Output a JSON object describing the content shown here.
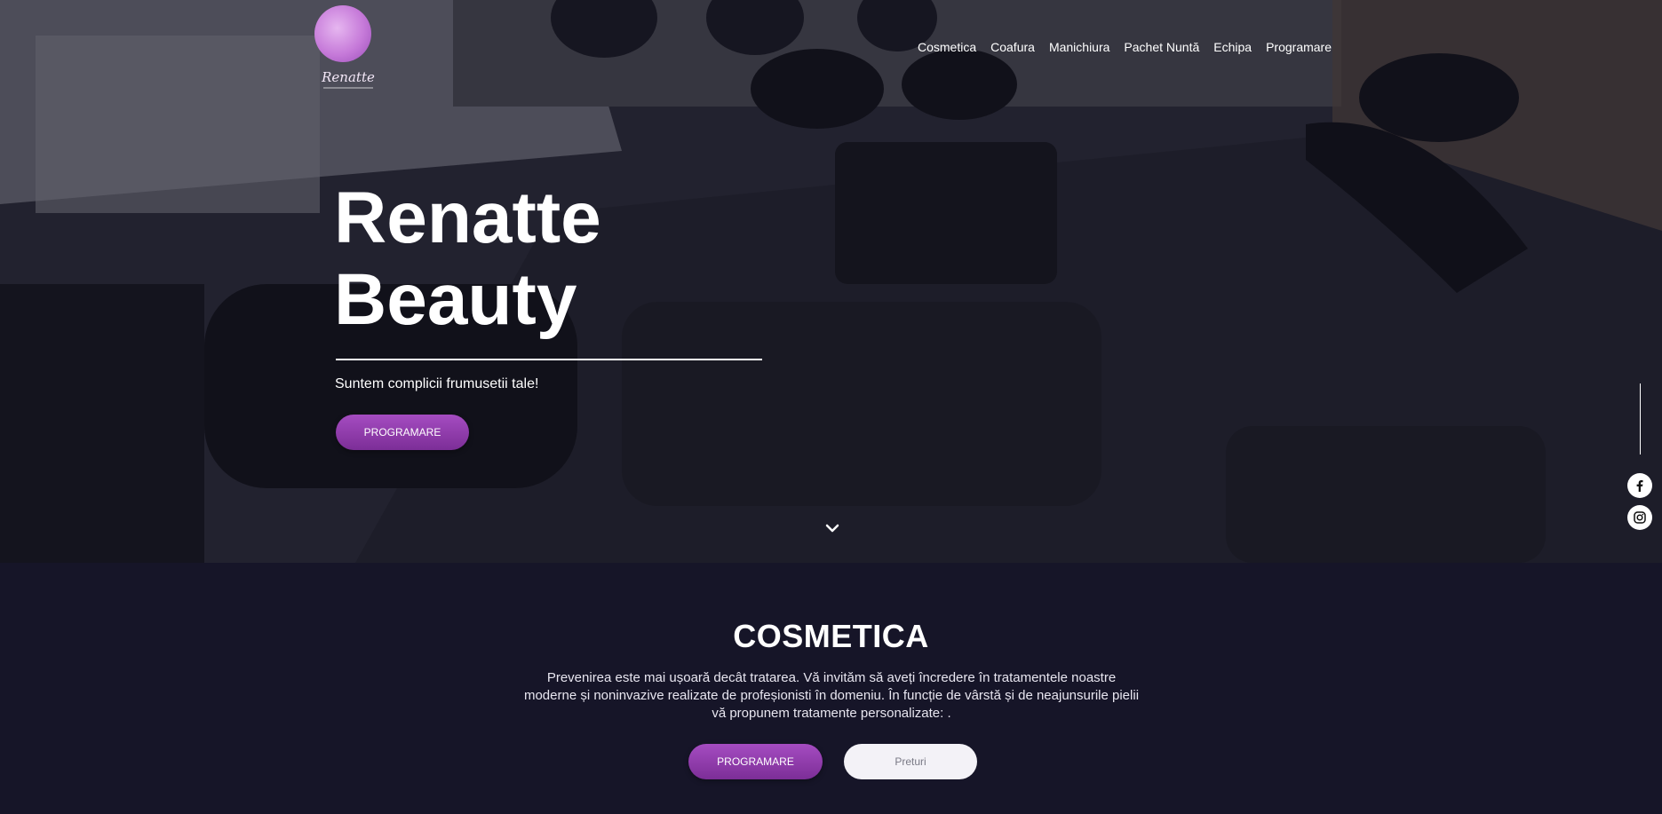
{
  "brand": {
    "logo_text": "Renatte"
  },
  "nav": {
    "items": [
      "Cosmetica",
      "Coafura",
      "Manichiura",
      "Pachet Nuntă",
      "Echipa",
      "Programare"
    ]
  },
  "hero": {
    "title_line1": "Renatte",
    "title_line2": "Beauty",
    "subtitle": "Suntem complicii frumusetii tale!",
    "button_label": "PROGRAMARE"
  },
  "icons": {
    "scroll": "chevron-down-icon",
    "facebook": "facebook-icon",
    "instagram": "instagram-icon"
  },
  "section": {
    "title": "COSMETICA",
    "text": "Prevenirea este mai ușoară decât tratarea. Vă invităm să aveți încredere în tratamentele noastre moderne și noninvazive realizate de profeșionisti în domeniu. În funcție de vârstă și de neajunsurile pielii vă propunem tratamente personalizate: .",
    "primary_button": "PROGRAMARE",
    "secondary_button": "Preturi"
  },
  "colors": {
    "accent": "#9b45b8",
    "section_bg": "#161528",
    "light_button": "#f3f2f7"
  }
}
